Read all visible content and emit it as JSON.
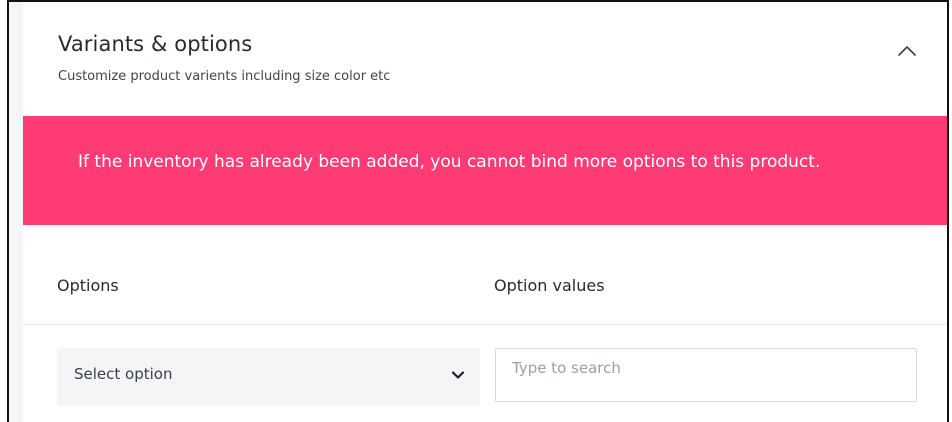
{
  "section": {
    "title": "Variants & options",
    "subtitle": "Customize product varients including size color etc",
    "toggle_icon": "chevron-up-icon"
  },
  "alert": {
    "message": "If the inventory has already been added, you cannot bind more options to this product.",
    "color": "#ff3b76"
  },
  "table": {
    "options_header": "Options",
    "option_values_header": "Option values"
  },
  "option_select": {
    "selected": "Select option",
    "icon": "chevron-down-icon"
  },
  "values_search": {
    "value": "",
    "placeholder": "Type to search"
  }
}
